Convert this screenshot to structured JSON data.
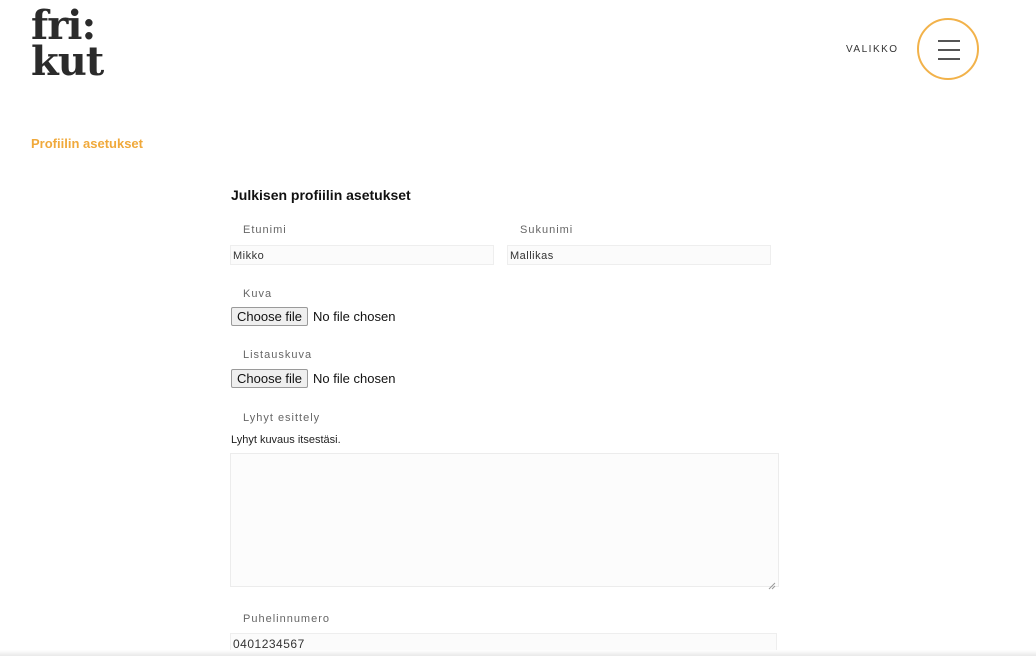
{
  "header": {
    "logo_line1": "fri:",
    "logo_line2": "kut",
    "menu_label": "VALIKKO"
  },
  "breadcrumb": "Profiilin asetukset",
  "form": {
    "title": "Julkisen profiilin asetukset",
    "first_name": {
      "label": "Etunimi",
      "value": "Mikko"
    },
    "last_name": {
      "label": "Sukunimi",
      "value": "Mallikas"
    },
    "image": {
      "label": "Kuva",
      "button": "Choose file",
      "status": "No file chosen"
    },
    "list_image": {
      "label": "Listauskuva",
      "button": "Choose file",
      "status": "No file chosen"
    },
    "intro": {
      "label": "Lyhyt esittely",
      "help": "Lyhyt kuvaus itsestäsi.",
      "value": ""
    },
    "phone": {
      "label": "Puhelinnumero",
      "value": "0401234567"
    }
  },
  "colors": {
    "accent": "#f0a93b",
    "menu_ring": "#f2b24a"
  }
}
